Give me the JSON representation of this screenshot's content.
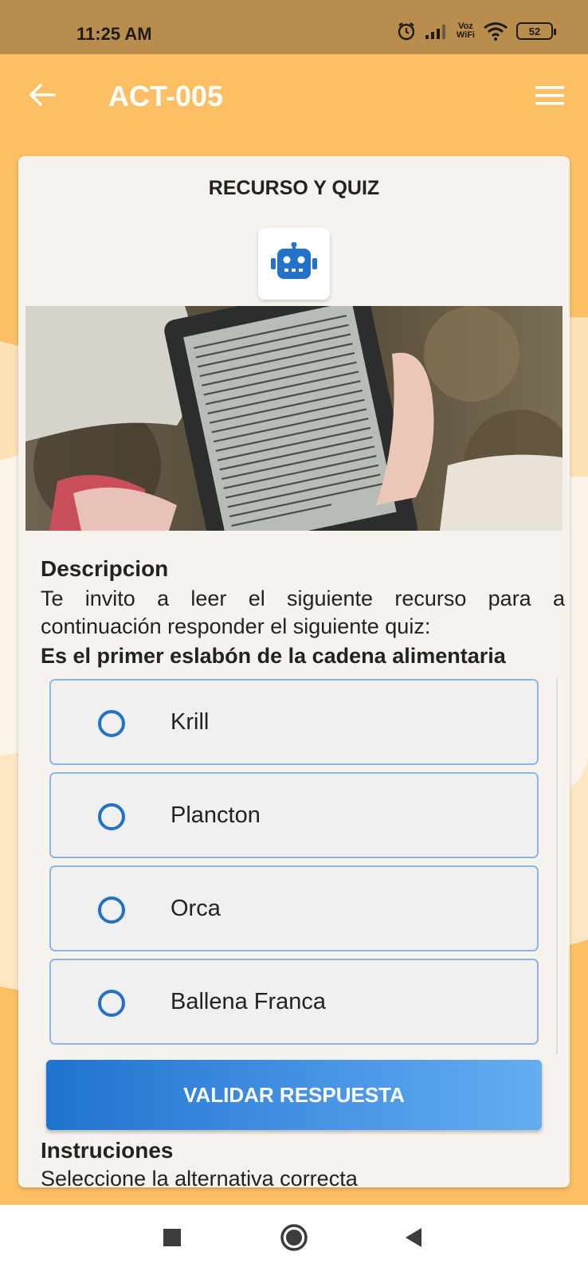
{
  "status_bar": {
    "time": "11:25 AM",
    "voz_line1": "Voz",
    "voz_line2": "WiFi",
    "battery": "52",
    "icons": [
      "alarm-icon",
      "signal-icon",
      "wifi-icon",
      "battery-icon"
    ]
  },
  "app_bar": {
    "title": "ACT-005",
    "back_icon": "arrow-left-icon",
    "menu_icon": "hamburger-menu-icon"
  },
  "card": {
    "title": "RECURSO Y QUIZ",
    "bot_icon": "robot-icon",
    "image_alt": "e-reader held in hands",
    "description_heading": "Descripcion",
    "description_text": "Te invito a leer el siguiente recurso para a continuación responder el siguiente quiz:",
    "question": "Es el primer eslabón de la cadena alimentaria",
    "options": [
      {
        "label": "Krill"
      },
      {
        "label": "Plancton"
      },
      {
        "label": "Orca"
      },
      {
        "label": "Ballena Franca"
      }
    ],
    "validate_label": "VALIDAR RESPUESTA",
    "instructions_heading": "Instruciones",
    "instructions_text": "Seleccione la alternativa correcta"
  },
  "colors": {
    "status_bar": "#b98d4d",
    "background": "#fcbf63",
    "accent_blue": "#2371c9",
    "card": "#f6f3ef"
  },
  "nav_bar": {
    "icons": [
      "recents-square-icon",
      "home-circle-icon",
      "back-triangle-icon"
    ]
  }
}
